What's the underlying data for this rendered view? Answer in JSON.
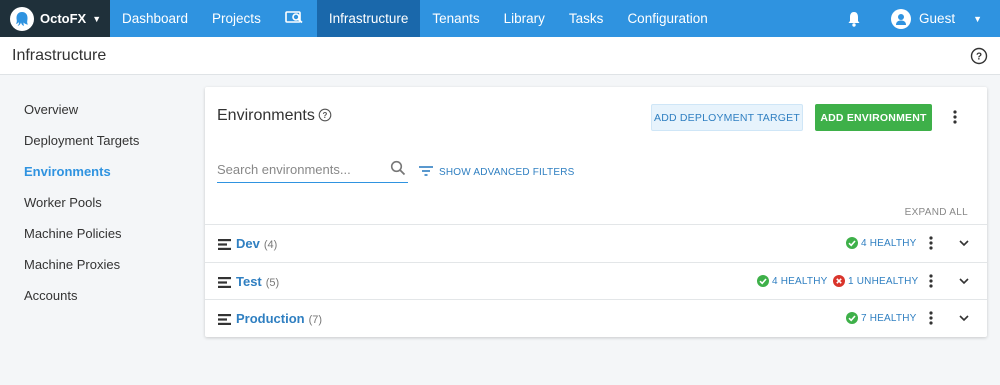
{
  "app": {
    "brand": "OctoFX"
  },
  "nav": {
    "items": [
      {
        "label": "Dashboard",
        "active": false
      },
      {
        "label": "Projects",
        "active": false
      },
      {
        "label": "",
        "icon": "search-projects-icon",
        "active": false
      },
      {
        "label": "Infrastructure",
        "active": true
      },
      {
        "label": "Tenants",
        "active": false
      },
      {
        "label": "Library",
        "active": false
      },
      {
        "label": "Tasks",
        "active": false
      },
      {
        "label": "Configuration",
        "active": false
      }
    ],
    "user": "Guest"
  },
  "page": {
    "title": "Infrastructure"
  },
  "sidebar": {
    "items": [
      {
        "label": "Overview",
        "active": false
      },
      {
        "label": "Deployment Targets",
        "active": false
      },
      {
        "label": "Environments",
        "active": true
      },
      {
        "label": "Worker Pools",
        "active": false
      },
      {
        "label": "Machine Policies",
        "active": false
      },
      {
        "label": "Machine Proxies",
        "active": false
      },
      {
        "label": "Accounts",
        "active": false
      }
    ]
  },
  "card": {
    "title": "Environments",
    "add_target_label": "ADD DEPLOYMENT TARGET",
    "add_env_label": "ADD ENVIRONMENT",
    "search_placeholder": "Search environments...",
    "advanced_filters_label": "SHOW ADVANCED FILTERS",
    "expand_all_label": "EXPAND ALL"
  },
  "environments": [
    {
      "name": "Dev",
      "count": "(4)",
      "healthy": "4 HEALTHY",
      "unhealthy": ""
    },
    {
      "name": "Test",
      "count": "(5)",
      "healthy": "4 HEALTHY",
      "unhealthy": "1 UNHEALTHY"
    },
    {
      "name": "Production",
      "count": "(7)",
      "healthy": "7 HEALTHY",
      "unhealthy": ""
    }
  ],
  "colors": {
    "nav": "#2f93e0",
    "nav_active": "#1a68ab",
    "brand_bg": "#1f303a",
    "link": "#2f7fc1",
    "healthy": "#3eb049",
    "unhealthy": "#d9342b",
    "primary_button": "#3eb049"
  }
}
